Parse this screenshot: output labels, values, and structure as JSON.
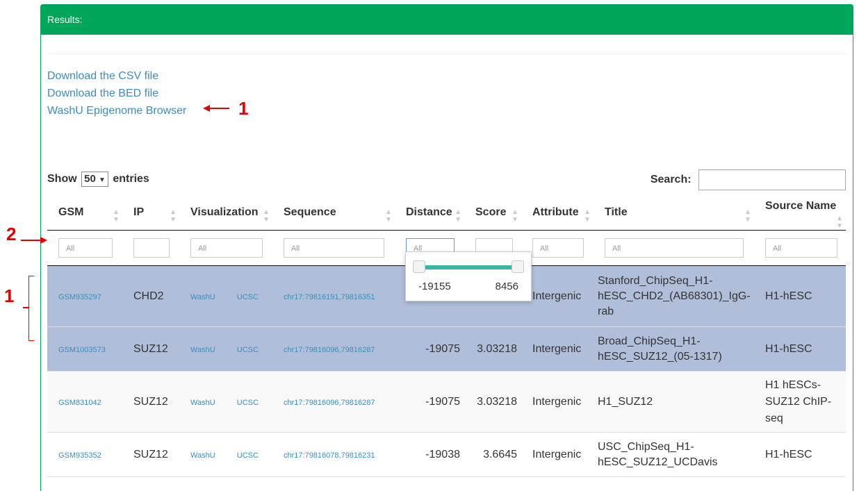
{
  "panel": {
    "title": "Results:"
  },
  "downloads": {
    "csv": "Download the CSV file",
    "bed": "Download the BED file",
    "washu": "WashU Epigenome Browser"
  },
  "annotations": {
    "label1": "1",
    "label2": "2",
    "label1b": "1"
  },
  "table_controls": {
    "show_prefix": "Show",
    "show_value": "50",
    "show_suffix": "entries",
    "search_label": "Search:",
    "search_value": ""
  },
  "columns": [
    "GSM",
    "IP",
    "Visualization",
    "Sequence",
    "Distance",
    "Score",
    "Attribute",
    "Title",
    "Source Name"
  ],
  "filters": [
    "All",
    "",
    "All",
    "All",
    "All",
    "",
    "All",
    "All",
    "All"
  ],
  "range_filter": {
    "min": "-19155",
    "max": "8456"
  },
  "rows": [
    {
      "gsm": "GSM935297",
      "ip": "CHD2",
      "viz1": "WashU",
      "viz2": "UCSC",
      "seq": "chr17:79816191,79816351",
      "distance": "",
      "score": "",
      "attribute": "Intergenic",
      "title": "Stanford_ChipSeq_H1-hESC_CHD2_(AB68301)_IgG-rab",
      "source": "H1-hESC"
    },
    {
      "gsm": "GSM1003573",
      "ip": "SUZ12",
      "viz1": "WashU",
      "viz2": "UCSC",
      "seq": "chr17:79816096,79816287",
      "distance": "-19075",
      "score": "3.03218",
      "attribute": "Intergenic",
      "title": "Broad_ChipSeq_H1-hESC_SUZ12_(05-1317)",
      "source": "H1-hESC"
    },
    {
      "gsm": "GSM831042",
      "ip": "SUZ12",
      "viz1": "WashU",
      "viz2": "UCSC",
      "seq": "chr17:79816096,79816287",
      "distance": "-19075",
      "score": "3.03218",
      "attribute": "Intergenic",
      "title": "H1_SUZ12",
      "source": "H1 hESCs-SUZ12 ChIP-seq"
    },
    {
      "gsm": "GSM935352",
      "ip": "SUZ12",
      "viz1": "WashU",
      "viz2": "UCSC",
      "seq": "chr17:79816078,79816231",
      "distance": "-19038",
      "score": "3.6645",
      "attribute": "Intergenic",
      "title": "USC_ChipSeq_H1-hESC_SUZ12_UCDavis",
      "source": "H1-hESC"
    }
  ],
  "colors": {
    "header": "#00a65a",
    "link": "#3c8dbc",
    "selected_row": "#b0bed9",
    "annotation": "#e00000"
  }
}
